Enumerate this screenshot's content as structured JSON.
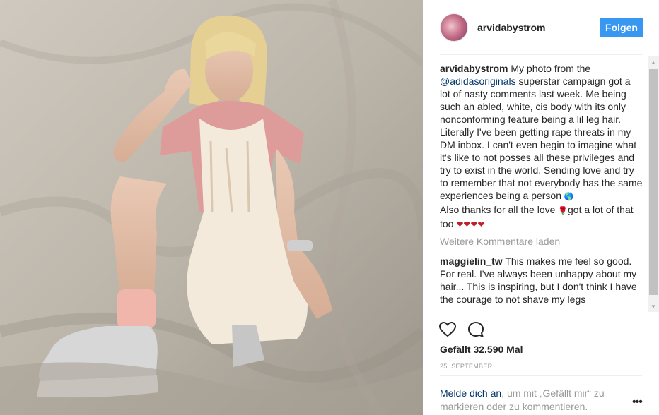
{
  "post": {
    "photo_alt": "",
    "author": "arvidabystrom",
    "follow_label": "Folgen",
    "caption_part1": " My photo from the ",
    "caption_mention": "@adidasoriginals",
    "caption_part2": " superstar campaign got a lot of nasty comments last week. Me being such an abled, white, cis body with its only nonconforming feature being a lil leg hair. Literally I've been getting rape threats in my DM inbox. I can't even begin to imagine what it's like to not posses all these privileges and try to exist in the world. Sending love and try to remember that not everybody has the same experiences being a person ",
    "caption_emoji_globe": "🌎",
    "caption_part3": "Also thanks for all the love ",
    "caption_emoji_rose": "🌹",
    "caption_part4": "got a lot of that too ",
    "caption_hearts": "❤❤❤❤",
    "load_more": "Weitere Kommentare laden",
    "comments": [
      {
        "author": "maggielin_tw",
        "text": " This makes me feel so good. For real. I've always been unhappy about my hair... This is inspiring, but I don't think I have the courage to not shave my legs"
      }
    ],
    "likes": "Gefällt 32.590 Mal",
    "date": "25. SEPTEMBER",
    "login_link": "Melde dich an",
    "login_rest": ", um mit „Gefällt mir“ zu markieren oder zu kommentieren.",
    "more_label": "•••"
  },
  "icons": {
    "heart": "heart-icon",
    "comment": "comment-icon",
    "more": "more-options-icon",
    "scroll_up": "▲",
    "scroll_down": "▼"
  },
  "colors": {
    "follow_button": "#3897f0",
    "mention": "#003569",
    "muted": "#999999",
    "text": "#262626"
  }
}
